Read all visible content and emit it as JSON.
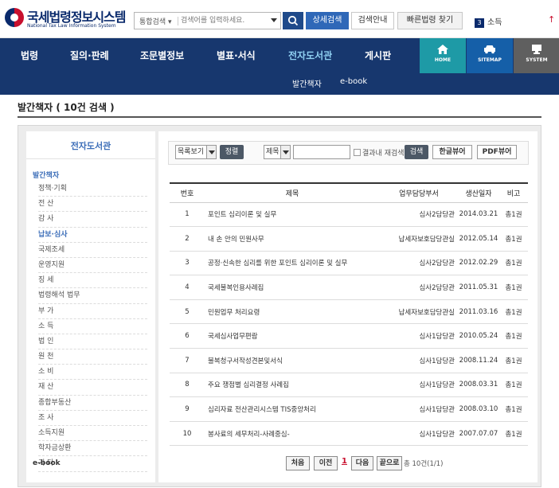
{
  "header": {
    "logo_title": "국세법령정보시스템",
    "logo_subtitle": "National Tax Law Information System",
    "search_scope": "통합검색",
    "search_placeholder": "검색어를 입력하세요.",
    "detail_search": "상세검색",
    "search_guide": "검색안내",
    "quick_law": "빠른법령 찾기",
    "subscribe_count": "3",
    "subscribe_label": "소득"
  },
  "nav": {
    "items": [
      "법령",
      "질의·판례",
      "조문별정보",
      "별표·서식",
      "전자도서관",
      "게시판"
    ],
    "home": "HOME",
    "sitemap": "SITEMAP",
    "system": "SYSTEM",
    "sub_items": [
      "발간책자",
      "e-book"
    ]
  },
  "page_title": "발간책자 ( 10건 검색 )",
  "sidebar": {
    "heading": "전자도서관",
    "group": "발간책자",
    "items": [
      "정책·기획",
      "전 산",
      "감 사",
      "납보·심사",
      "국제조세",
      "운영지원",
      "징 세",
      "법령해석 법무",
      "부 가",
      "소 득",
      "법 인",
      "원 천",
      "소 비",
      "재 산",
      "종합부동산",
      "조 사",
      "소득지원",
      "학자금상환",
      "기 타"
    ],
    "active_index": 3,
    "bottom": "e-book"
  },
  "toolbar": {
    "view_select": "목록보기",
    "sort_button": "정렬",
    "field_select": "제목",
    "search_text": "",
    "within_results": "결과내 재검색",
    "search_button": "검색",
    "hangul_viewer": "한글뷰어",
    "pdf_viewer": "PDF뷰어"
  },
  "table": {
    "headers": [
      "번호",
      "제목",
      "업무담당부서",
      "생산일자",
      "비고"
    ],
    "rows": [
      [
        "1",
        "포인트 심리이론 및 실무",
        "심사2담당관",
        "2014.03.21",
        "총1권"
      ],
      [
        "2",
        "내 손 안의 민원사무",
        "납세자보호담당관실",
        "2012.05.14",
        "총1권"
      ],
      [
        "3",
        "공정·신속한 심리를 위한 포인트 심리이론 및 실무",
        "심사2담당관",
        "2012.02.29",
        "총1권"
      ],
      [
        "4",
        "국세불복인용사례집",
        "심사2담당관",
        "2011.05.31",
        "총1권"
      ],
      [
        "5",
        "민원업무 처리요령",
        "납세자보호담당관실",
        "2011.03.16",
        "총1권"
      ],
      [
        "6",
        "국세심사업무편람",
        "심사1담당관",
        "2010.05.24",
        "총1권"
      ],
      [
        "7",
        "불복청구서작성견본및서식",
        "심사1담당관",
        "2008.11.24",
        "총1권"
      ],
      [
        "8",
        "주요 쟁점별 심리결정 사례집",
        "심사1담당관",
        "2008.03.31",
        "총1권"
      ],
      [
        "9",
        "심리자료 전산관리시스템 TIS중앙처리",
        "심사1담당관",
        "2008.03.10",
        "총1권"
      ],
      [
        "10",
        "봉사료의 세무처리-사례중심-",
        "심사1담당관",
        "2007.07.07",
        "총1권"
      ]
    ]
  },
  "pager": {
    "first": "처음",
    "prev": "이전",
    "current": "1",
    "next": "다음",
    "last": "끝으로",
    "total": "총 10건(1/1)"
  }
}
